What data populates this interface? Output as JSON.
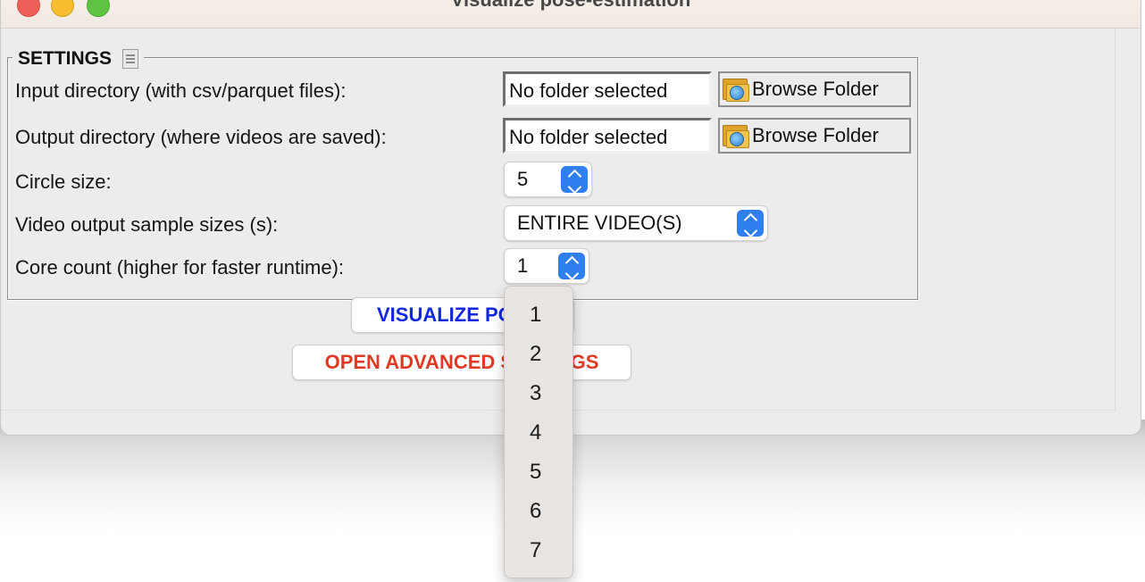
{
  "window": {
    "title": "Visualize pose-estimation"
  },
  "settings": {
    "legend": "SETTINGS",
    "input_dir_label": "Input directory (with csv/parquet files):",
    "input_dir_value": "No folder selected",
    "output_dir_label": "Output directory (where videos are saved):",
    "output_dir_value": "No folder selected",
    "browse_label": "Browse Folder",
    "circle_size_label": "Circle size:",
    "circle_size_value": "5",
    "sample_size_label": "Video output sample sizes (s):",
    "sample_size_value": "ENTIRE VIDEO(S)",
    "core_count_label": "Core count (higher for faster runtime):",
    "core_count_value": "1"
  },
  "buttons": {
    "visualize": "VISUALIZE PO",
    "advanced": "OPEN ADVANCED SETTINGS"
  },
  "dropdown": {
    "options": [
      "1",
      "2",
      "3",
      "4",
      "5",
      "6",
      "7"
    ]
  },
  "colors": {
    "accent_blue": "#2f7ff0",
    "visualize_text": "#1228e0",
    "advanced_text": "#e03a24"
  }
}
